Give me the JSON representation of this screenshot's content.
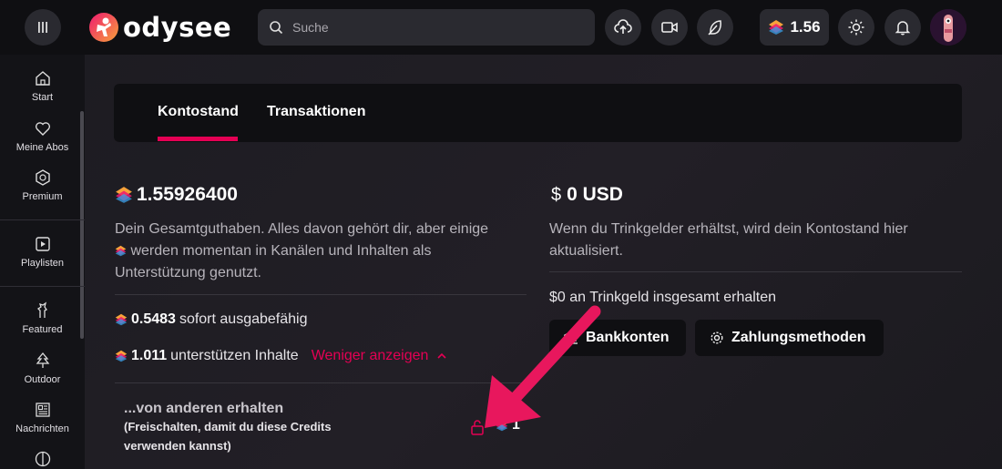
{
  "header": {
    "logo_text": "odysee",
    "search_placeholder": "Suche",
    "balance": "1.56"
  },
  "sidebar": {
    "items": [
      {
        "label": "Start",
        "icon": "home-icon"
      },
      {
        "label": "Meine Abos",
        "icon": "heart-icon"
      },
      {
        "label": "Premium",
        "icon": "premium-badge-icon"
      },
      {
        "label": "Playlisten",
        "icon": "playlist-icon"
      },
      {
        "label": "Featured",
        "icon": "featured-icon"
      },
      {
        "label": "Outdoor",
        "icon": "tree-icon"
      },
      {
        "label": "Nachrichten",
        "icon": "newspaper-icon"
      }
    ]
  },
  "tabs": [
    {
      "label": "Kontostand",
      "active": true
    },
    {
      "label": "Transaktionen",
      "active": false
    }
  ],
  "wallet": {
    "total": "1.55926400",
    "description_part1": "Dein Gesamtguthaben. Alles davon gehört dir, aber einige",
    "description_part2": "werden momentan in Kanälen und Inhalten als",
    "description_part3": "Unterstützung genutzt.",
    "spendable_amount": "0.5483",
    "spendable_label": "sofort ausgabefähig",
    "supporting_amount": "1.011",
    "supporting_label": "unterstützen Inhalte",
    "show_less": "Weniger anzeigen",
    "received_title": "...von anderen erhalten",
    "received_note": "(Freischalten, damit du diese Credits verwenden kannst)",
    "received_amount": "1"
  },
  "usd": {
    "currency_symbol": "$",
    "amount": "0 USD",
    "description": "Wenn du Trinkgelder erhältst, wird dein Kontostand hier aktualisiert.",
    "total_received": "$0 an Trinkgeld insgesamt erhalten",
    "bank_button": "Bankkonten",
    "payment_button": "Zahlungsmethoden"
  },
  "colors": {
    "accent": "#e50054",
    "background": "#1b1a1f",
    "header": "#0f0f12"
  }
}
